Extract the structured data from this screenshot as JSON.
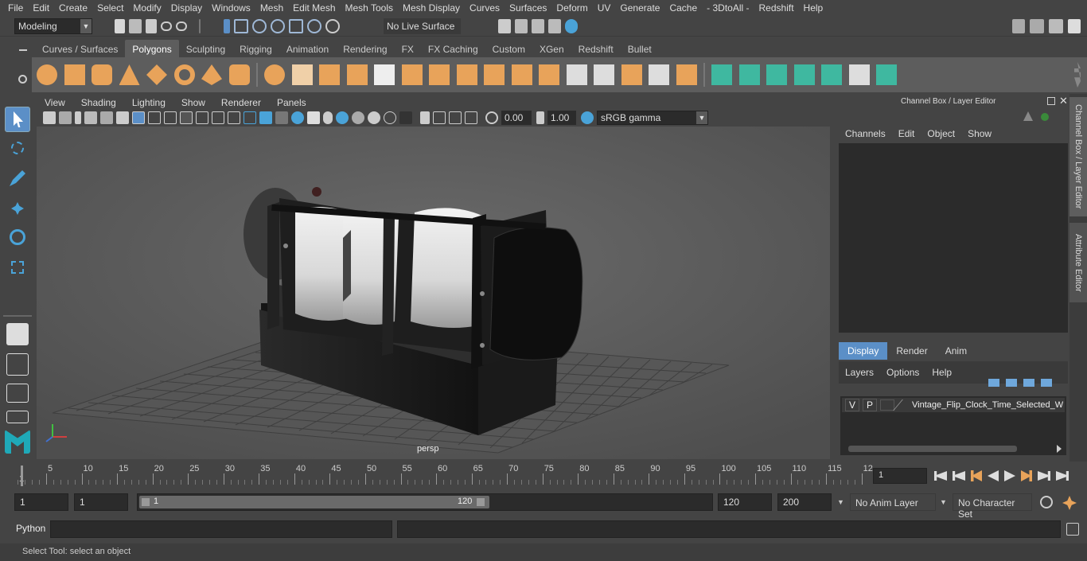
{
  "menubar": {
    "items": [
      "File",
      "Edit",
      "Create",
      "Select",
      "Modify",
      "Display",
      "Windows",
      "Mesh",
      "Edit Mesh",
      "Mesh Tools",
      "Mesh Display",
      "Curves",
      "Surfaces",
      "Deform",
      "UV",
      "Generate",
      "Cache",
      "- 3DtoAll -",
      "Redshift",
      "Help"
    ]
  },
  "status_line": {
    "mode": "Modeling",
    "live_surface": "No Live Surface"
  },
  "shelf": {
    "tabs": [
      "Curves / Surfaces",
      "Polygons",
      "Sculpting",
      "Rigging",
      "Animation",
      "Rendering",
      "FX",
      "FX Caching",
      "Custom",
      "XGen",
      "Redshift",
      "Bullet"
    ],
    "active_tab": "Polygons"
  },
  "viewport": {
    "menus": [
      "View",
      "Shading",
      "Lighting",
      "Show",
      "Renderer",
      "Panels"
    ],
    "exposure": "0.00",
    "gamma": "1.00",
    "color_space": "sRGB gamma",
    "camera_label": "persp"
  },
  "channel_box": {
    "title": "Channel Box / Layer Editor",
    "menus": [
      "Channels",
      "Edit",
      "Object",
      "Show"
    ],
    "tabs": [
      "Display",
      "Render",
      "Anim"
    ],
    "active_tab": "Display",
    "layer_menus": [
      "Layers",
      "Options",
      "Help"
    ],
    "layer": {
      "v": "V",
      "p": "P",
      "name": "Vintage_Flip_Clock_Time_Selected_W"
    }
  },
  "side_tabs": [
    "Channel Box / Layer Editor",
    "Attribute Editor"
  ],
  "timeline": {
    "ticks": [
      "5",
      "10",
      "15",
      "20",
      "25",
      "30",
      "35",
      "40",
      "45",
      "50",
      "55",
      "60",
      "65",
      "70",
      "75",
      "80",
      "85",
      "90",
      "95",
      "100",
      "105",
      "110",
      "115",
      "12"
    ],
    "start_marker": "1",
    "current_frame": "1"
  },
  "range": {
    "start": "1",
    "playback_start": "1",
    "slider_start": "1",
    "slider_end": "120",
    "playback_end": "120",
    "end": "200",
    "anim_layer": "No Anim Layer",
    "character_set": "No Character Set"
  },
  "command_line": {
    "label": "Python"
  },
  "help_line": {
    "text": "Select Tool: select an object"
  },
  "colors": {
    "accent_orange": "#e8a35a",
    "accent_teal": "#3fb8a0",
    "accent_blue": "#5b8fc7"
  }
}
